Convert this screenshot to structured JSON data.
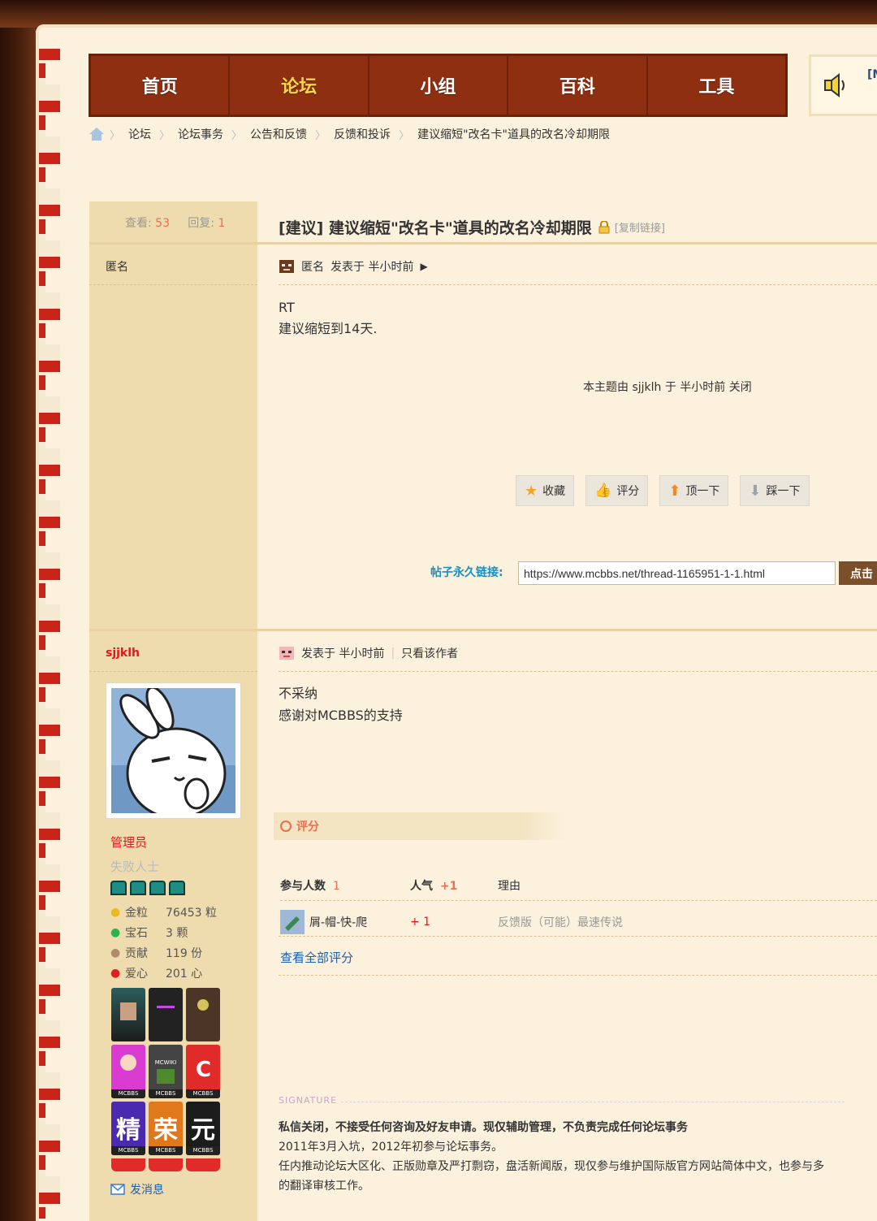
{
  "nav": {
    "items": [
      "首页",
      "论坛",
      "小组",
      "百科",
      "工具"
    ],
    "active_index": 1,
    "speaker_label": "[M"
  },
  "breadcrumb": [
    "论坛",
    "论坛事务",
    "公告和反馈",
    "反馈和投诉",
    "建议缩短\"改名卡\"道具的改名冷却期限"
  ],
  "thread": {
    "views_label": "查看:",
    "views": "53",
    "replies_label": "回复:",
    "replies": "1",
    "title": "[建议] 建议缩短\"改名卡\"道具的改名冷却期限",
    "copy_link": "[复制链接]"
  },
  "post1": {
    "author": "匿名",
    "meta_author": "匿名",
    "meta_time": "发表于 半小时前",
    "body_line1": "RT",
    "body_line2": "建议缩短到14天.",
    "closed_note": "本主题由 sjjklh 于 半小时前 关闭",
    "actions": [
      "收藏",
      "评分",
      "顶一下",
      "踩一下"
    ],
    "permalink_label": "帖子永久链接:",
    "permalink_url": "https://www.mcbbs.net/thread-1165951-1-1.html",
    "permalink_btn": "点击"
  },
  "post2": {
    "username": "sjjklh",
    "role": "管理员",
    "subtitle": "失败人士",
    "stats": [
      {
        "label": "金粒",
        "value": "76453 粒"
      },
      {
        "label": "宝石",
        "value": "3 颗"
      },
      {
        "label": "贡献",
        "value": "119 份"
      },
      {
        "label": "爱心",
        "value": "201 心"
      }
    ],
    "badge_texts": [
      "精",
      "荣",
      "元"
    ],
    "badge_foot": "MCBBS",
    "mcwiki": "MCWIKI",
    "send_msg": "发消息",
    "meta_time": "发表于 半小时前",
    "only_author": "只看该作者",
    "body_line1": "不采纳",
    "body_line2": "感谢对MCBBS的支持",
    "rate_title": "评分",
    "rate_cols": {
      "participants": "参与人数",
      "participants_count": "1",
      "popularity": "人气",
      "popularity_value": "+1",
      "reason": "理由"
    },
    "rate_row": {
      "user": "屑-帽-快-爬",
      "score": "+ 1",
      "reason": "反馈版（可能）最速传说"
    },
    "view_all": "查看全部评分",
    "sig_label": "SIGNATURE",
    "sig_line1": "私信关闭，不接受任何咨询及好友申请。现仅辅助管理，不负责完成任何论坛事务",
    "sig_line2": "2011年3月入坑，2012年初参与论坛事务。",
    "sig_line3": "任内推动论坛大区化、正版勋章及严打剽窃，盘活新闻版，现仅参与维护国际版官方网站简体中文，也参与多",
    "sig_line4": "的翻译审核工作。"
  },
  "colors": {
    "nav_bg": "#8e2f12",
    "active": "#ffd54a",
    "accent": "#f26c4f",
    "link": "#1f5ea8",
    "admin": "#e8151b"
  }
}
